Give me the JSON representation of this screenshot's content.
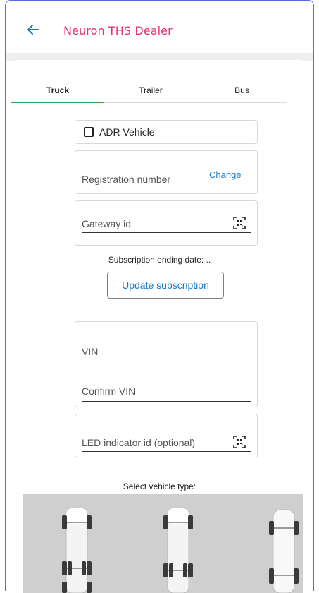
{
  "appbar": {
    "title": "Neuron THS Dealer",
    "back_icon": "arrow-left-icon"
  },
  "tabs": [
    {
      "label": "Truck",
      "active": true
    },
    {
      "label": "Trailer",
      "active": false
    },
    {
      "label": "Bus",
      "active": false
    }
  ],
  "form": {
    "adr_label": "ADR Vehicle",
    "adr_checked": false,
    "registration_placeholder": "Registration number",
    "change_label": "Change",
    "gateway_placeholder": "Gateway id",
    "subscription_text": "Subscription ending date: ..",
    "update_button": "Update subscription",
    "vin_placeholder": "VIN",
    "confirm_vin_placeholder": "Confirm VIN",
    "led_placeholder": "LED indicator id (optional)",
    "vehicle_type_label": "Select vehicle type:",
    "qr_icon": "qr-scan-icon"
  },
  "colors": {
    "title": "#e8306f",
    "tab_active": "#2eaa4a",
    "link": "#1a78c2",
    "frame": "#5b6bd6"
  }
}
